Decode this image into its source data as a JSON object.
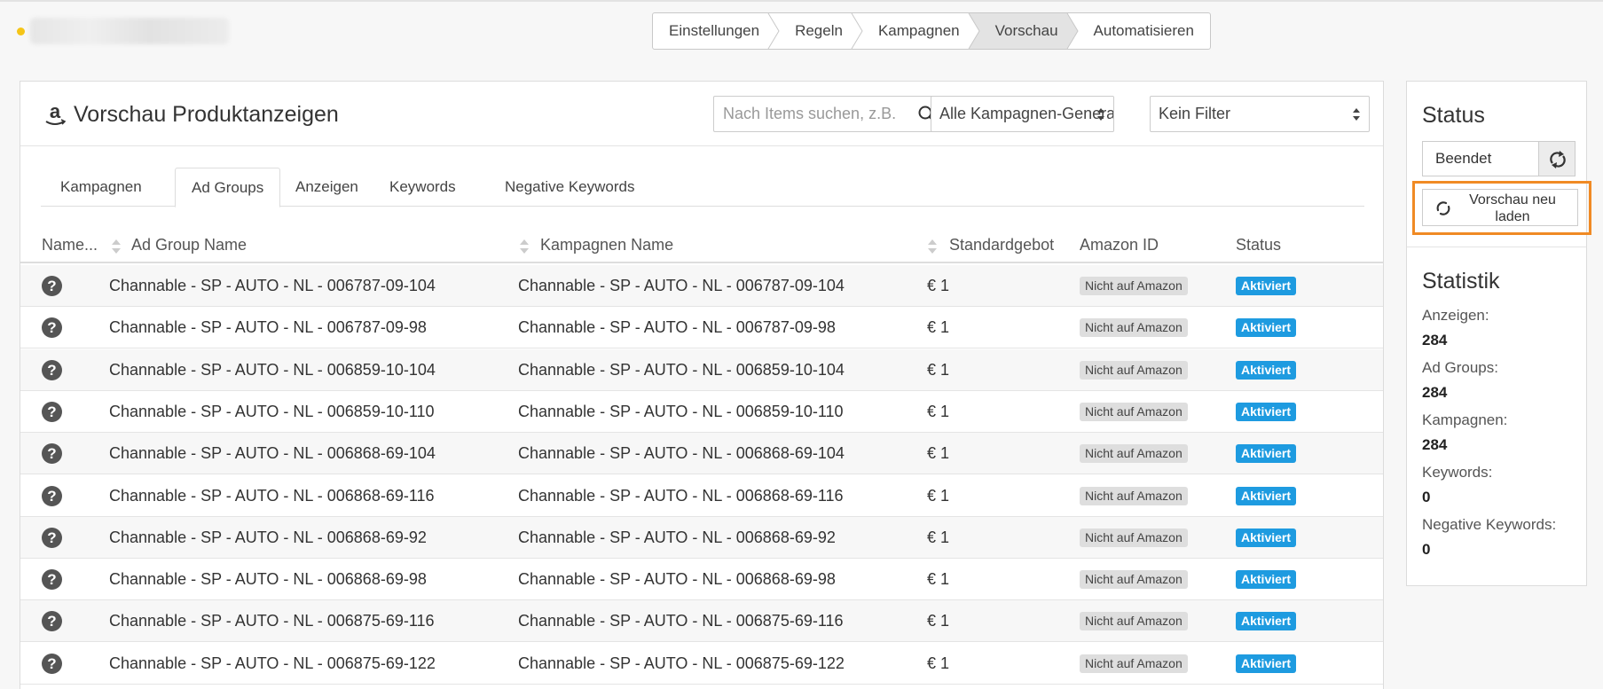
{
  "steps": [
    "Einstellungen",
    "Regeln",
    "Kampagnen",
    "Vorschau",
    "Automatisieren"
  ],
  "active_step": 3,
  "card": {
    "title": "Vorschau Produktanzeigen",
    "search_placeholder": "Nach Items suchen, z.B. 'Tisch'",
    "select_generator": "Alle Kampagnen-Generatoren",
    "select_filter": "Kein Filter"
  },
  "tabs": [
    "Kampagnen",
    "Ad Groups",
    "Anzeigen",
    "Keywords",
    "Negative Keywords"
  ],
  "active_tab": 1,
  "columns": {
    "name": "Name...",
    "ad_group": "Ad Group Name",
    "campaign": "Kampagnen Name",
    "bid": "Standardgebot",
    "amazon_id": "Amazon ID",
    "status": "Status"
  },
  "rows": [
    {
      "ad_group": "Channable - SP - AUTO - NL - 006787-09-104",
      "campaign": "Channable - SP - AUTO - NL - 006787-09-104",
      "bid": "€ 1",
      "amazon_id": "Nicht auf Amazon",
      "status": "Aktiviert"
    },
    {
      "ad_group": "Channable - SP - AUTO - NL - 006787-09-98",
      "campaign": "Channable - SP - AUTO - NL - 006787-09-98",
      "bid": "€ 1",
      "amazon_id": "Nicht auf Amazon",
      "status": "Aktiviert"
    },
    {
      "ad_group": "Channable - SP - AUTO - NL - 006859-10-104",
      "campaign": "Channable - SP - AUTO - NL - 006859-10-104",
      "bid": "€ 1",
      "amazon_id": "Nicht auf Amazon",
      "status": "Aktiviert"
    },
    {
      "ad_group": "Channable - SP - AUTO - NL - 006859-10-110",
      "campaign": "Channable - SP - AUTO - NL - 006859-10-110",
      "bid": "€ 1",
      "amazon_id": "Nicht auf Amazon",
      "status": "Aktiviert"
    },
    {
      "ad_group": "Channable - SP - AUTO - NL - 006868-69-104",
      "campaign": "Channable - SP - AUTO - NL - 006868-69-104",
      "bid": "€ 1",
      "amazon_id": "Nicht auf Amazon",
      "status": "Aktiviert"
    },
    {
      "ad_group": "Channable - SP - AUTO - NL - 006868-69-116",
      "campaign": "Channable - SP - AUTO - NL - 006868-69-116",
      "bid": "€ 1",
      "amazon_id": "Nicht auf Amazon",
      "status": "Aktiviert"
    },
    {
      "ad_group": "Channable - SP - AUTO - NL - 006868-69-92",
      "campaign": "Channable - SP - AUTO - NL - 006868-69-92",
      "bid": "€ 1",
      "amazon_id": "Nicht auf Amazon",
      "status": "Aktiviert"
    },
    {
      "ad_group": "Channable - SP - AUTO - NL - 006868-69-98",
      "campaign": "Channable - SP - AUTO - NL - 006868-69-98",
      "bid": "€ 1",
      "amazon_id": "Nicht auf Amazon",
      "status": "Aktiviert"
    },
    {
      "ad_group": "Channable - SP - AUTO - NL - 006875-69-116",
      "campaign": "Channable - SP - AUTO - NL - 006875-69-116",
      "bid": "€ 1",
      "amazon_id": "Nicht auf Amazon",
      "status": "Aktiviert"
    },
    {
      "ad_group": "Channable - SP - AUTO - NL - 006875-69-122",
      "campaign": "Channable - SP - AUTO - NL - 006875-69-122",
      "bid": "€ 1",
      "amazon_id": "Nicht auf Amazon",
      "status": "Aktiviert"
    }
  ],
  "sidebar": {
    "status_title": "Status",
    "status_value": "Beendet",
    "reload_label": "Vorschau neu laden",
    "stats_title": "Statistik",
    "stats": [
      {
        "label": "Anzeigen:",
        "value": "284"
      },
      {
        "label": "Ad Groups:",
        "value": "284"
      },
      {
        "label": "Kampagnen:",
        "value": "284"
      },
      {
        "label": "Keywords:",
        "value": "0"
      },
      {
        "label": "Negative Keywords:",
        "value": "0"
      }
    ]
  },
  "colors": {
    "accent_blue": "#1e9be0",
    "highlight_orange": "#f08a24",
    "status_dot": "#f5c518"
  },
  "icons": {
    "amazon": "amazon-logo-icon",
    "search": "search-icon",
    "refresh": "refresh-icon",
    "reload": "spinner-icon",
    "row": "question-circle-icon"
  }
}
